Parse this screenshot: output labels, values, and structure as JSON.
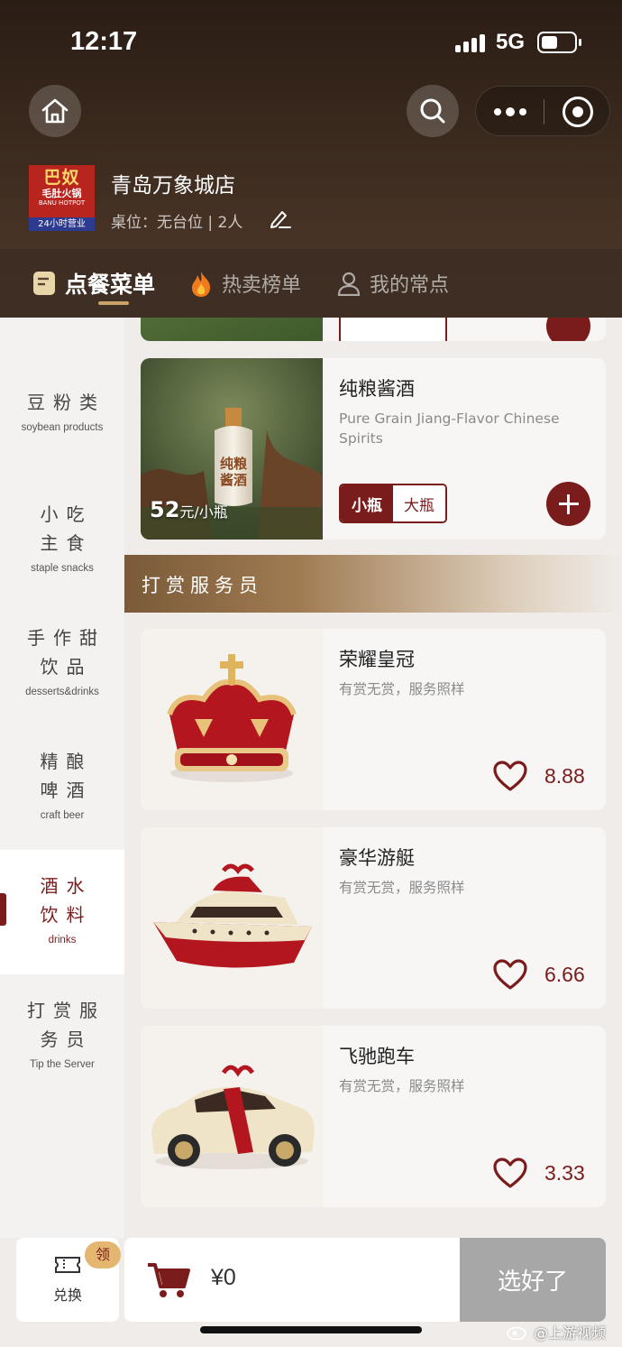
{
  "status_bar": {
    "time": "12:17",
    "network": "5G"
  },
  "store": {
    "logo_line1": "巴奴",
    "logo_line2": "毛肚火锅",
    "logo_line3": "BANU HOTPOT",
    "logo_line4": "24小时营业",
    "name": "青岛万象城店",
    "table_info": "桌位：无台位 | 2人"
  },
  "tabs": [
    {
      "label": "点餐菜单",
      "icon": "menu-note-icon"
    },
    {
      "label": "热卖榜单",
      "icon": "fire-icon"
    },
    {
      "label": "我的常点",
      "icon": "user-icon"
    }
  ],
  "sidebar": {
    "items": [
      {
        "zh": "豆粉类",
        "en": "soybean products"
      },
      {
        "zh": "小吃主食",
        "en": "staple snacks"
      },
      {
        "zh": "手作甜饮品",
        "en": "desserts&drinks"
      },
      {
        "zh": "精酿啤酒",
        "en": "craft beer"
      },
      {
        "zh": "酒水饮料",
        "en": "drinks"
      },
      {
        "zh": "打赏服务员",
        "en": "Tip the Server"
      }
    ],
    "active_index": 4
  },
  "products": {
    "spirits": {
      "title": "纯粮酱酒",
      "subtitle": "Pure Grain Jiang-Flavor Chinese Spirits",
      "price": "52",
      "unit": "元/小瓶",
      "bottle_text": "纯粮\n酱酒",
      "size_small": "小瓶",
      "size_large": "大瓶"
    }
  },
  "section": {
    "title": "打赏服务员"
  },
  "tips": [
    {
      "title": "荣耀皇冠",
      "subtitle": "有赏无赏，服务照样",
      "amount": "8.88",
      "image": "crown"
    },
    {
      "title": "豪华游艇",
      "subtitle": "有赏无赏，服务照样",
      "amount": "6.66",
      "image": "yacht"
    },
    {
      "title": "飞驰跑车",
      "subtitle": "有赏无赏，服务照样",
      "amount": "3.33",
      "image": "sports-car"
    }
  ],
  "bottom": {
    "exchange_label": "兑换",
    "exchange_badge": "领",
    "cart_total": "¥0",
    "checkout_label": "选好了"
  },
  "watermark": "@上游视频",
  "colors": {
    "accent": "#7a1c1c",
    "gold": "#c8a267",
    "checkout_disabled": "#a7a7a7"
  }
}
